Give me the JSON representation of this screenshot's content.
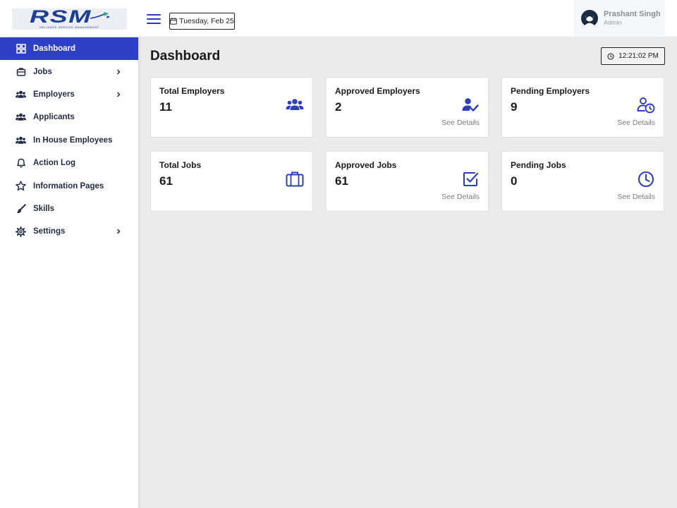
{
  "header": {
    "logo_text": "RSM",
    "logo_subtext": "RELIANCE SERVICE MANAGEMENT",
    "date": "Tuesday, Feb 25",
    "user_name": "Prashant Singh",
    "user_role": "Admin"
  },
  "sidebar": {
    "items": [
      {
        "label": "Dashboard",
        "icon": "grid-icon"
      },
      {
        "label": "Jobs",
        "icon": "briefcase-icon"
      },
      {
        "label": "Employers",
        "icon": "users-icon"
      },
      {
        "label": "Applicants",
        "icon": "users-icon"
      },
      {
        "label": "In House Employees",
        "icon": "users-icon"
      },
      {
        "label": "Action Log",
        "icon": "bell-icon"
      },
      {
        "label": "Information Pages",
        "icon": "star-icon"
      },
      {
        "label": "Skills",
        "icon": "brush-icon"
      },
      {
        "label": "Settings",
        "icon": "gear-icon"
      }
    ]
  },
  "main": {
    "title": "Dashboard",
    "time": "12:21:02 PM",
    "cards": [
      {
        "title": "Total Employers",
        "value": "11",
        "icon": "users-icon",
        "link": ""
      },
      {
        "title": "Approved Employers",
        "value": "2",
        "icon": "user-check-icon",
        "link": "See Details"
      },
      {
        "title": "Pending Employers",
        "value": "9",
        "icon": "user-clock-icon",
        "link": "See Details"
      },
      {
        "title": "Total Jobs",
        "value": "61",
        "icon": "briefcase-icon",
        "link": ""
      },
      {
        "title": "Approved Jobs",
        "value": "61",
        "icon": "checkbox-icon",
        "link": "See Details"
      },
      {
        "title": "Pending Jobs",
        "value": "0",
        "icon": "clock-icon",
        "link": "See Details"
      }
    ]
  },
  "colors": {
    "accent": "#2d3fc5",
    "icon": "#2d3fb8",
    "background": "#ebebeb"
  }
}
